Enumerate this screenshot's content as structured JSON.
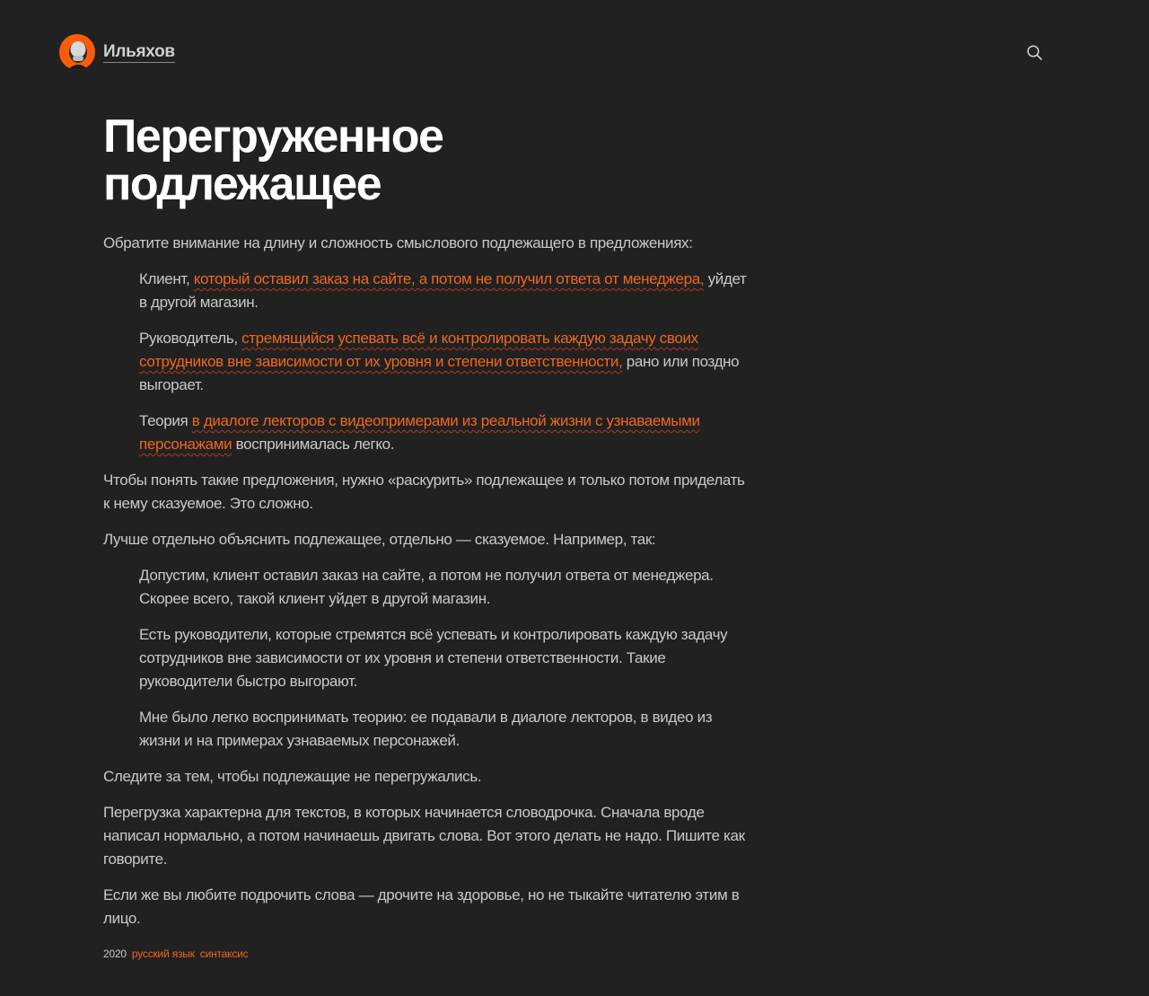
{
  "header": {
    "site_name": "Ильяхов",
    "search_icon": "search-icon",
    "avatar": "avatar-photo"
  },
  "article": {
    "title": "Перегруженное подлежащее",
    "intro": "Обратите внимание на длину и сложность смыслового подлежащего в предложениях:",
    "examples": [
      {
        "before": "Клиент, ",
        "highlight": "который оставил заказ на сайте, а потом не получил ответа от менеджера,",
        "after": " уйдет в другой магазин."
      },
      {
        "before": "Руководитель, ",
        "highlight": "стремящийся успевать всё и контролировать каждую задачу своих сотрудников вне зависимости от их уровня и степени ответственности,",
        "after": " рано или поздно выгорает."
      },
      {
        "before": "Теория ",
        "highlight": "в диалоге лекторов с видеопримерами из реальной жизни с узнаваемыми персонажами",
        "after": " воспринималась легко."
      }
    ],
    "para_understand": "Чтобы понять такие предложения, нужно «раскурить» подлежащее и только потом приделать к нему сказуемое. Это сложно.",
    "para_better": "Лучше отдельно объяснить подлежащее, отдельно — сказуемое. Например, так:",
    "rewrites": [
      "Допустим, клиент оставил заказ на сайте, а потом не получил ответа от менеджера. Скорее всего, такой клиент уйдет в другой магазин.",
      "Есть руководители, которые стремятся всё успевать и контролировать каждую задачу сотрудников вне зависимости от их уровня и степени ответственности. Такие руководители быстро выгорают.",
      "Мне было легко воспринимать теорию: ее подавали в диалоге лекторов, в видео из жизни и на примерах узнаваемых персонажей."
    ],
    "para_watch": "Следите за тем, чтобы подлежащие не перегружались.",
    "para_overload": "Перегрузка характерна для текстов, в которых начинается словодрочка. Сначала вроде написал нормально, а потом начинаешь двигать слова. Вот этого делать не надо. Пишите как говорите.",
    "para_last": "Если же вы любите подрочить слова — дрочите на здоровье, но не тыкайте читателю этим в лицо."
  },
  "meta": {
    "year": "2020",
    "tags": [
      "русский язык",
      "синтаксис"
    ]
  },
  "colors": {
    "background": "#212121",
    "accent": "#f0671e",
    "text": "#c9c9c9",
    "title": "#ffffff"
  }
}
